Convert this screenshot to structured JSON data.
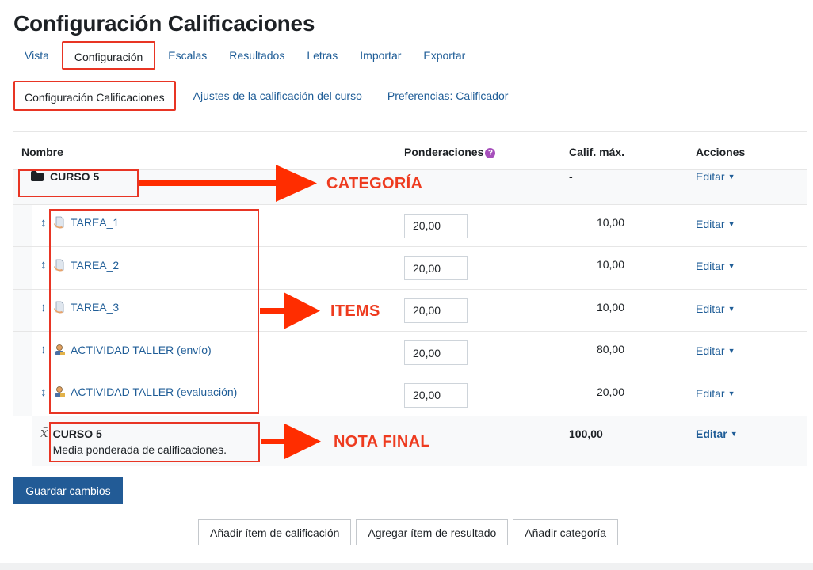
{
  "page": {
    "title": "Configuración Calificaciones"
  },
  "tabs_primary": [
    {
      "label": "Vista"
    },
    {
      "label": "Configuración"
    },
    {
      "label": "Escalas"
    },
    {
      "label": "Resultados"
    },
    {
      "label": "Letras"
    },
    {
      "label": "Importar"
    },
    {
      "label": "Exportar"
    }
  ],
  "tabs_secondary": [
    {
      "label": "Configuración Calificaciones"
    },
    {
      "label": "Ajustes de la calificación del curso"
    },
    {
      "label": "Preferencias: Calificador"
    }
  ],
  "table": {
    "headers": {
      "name": "Nombre",
      "weights": "Ponderaciones",
      "max": "Calif. máx.",
      "actions": "Acciones"
    },
    "category": {
      "name": "CURSO 5",
      "max": "-",
      "action": "Editar"
    },
    "items": [
      {
        "name": "TAREA_1",
        "weight": "20,00",
        "max": "10,00",
        "action": "Editar"
      },
      {
        "name": "TAREA_2",
        "weight": "20,00",
        "max": "10,00",
        "action": "Editar"
      },
      {
        "name": "TAREA_3",
        "weight": "20,00",
        "max": "10,00",
        "action": "Editar"
      },
      {
        "name": "ACTIVIDAD TALLER (envío)",
        "weight": "20,00",
        "max": "80,00",
        "action": "Editar"
      },
      {
        "name": "ACTIVIDAD TALLER (evaluación)",
        "weight": "20,00",
        "max": "20,00",
        "action": "Editar"
      }
    ],
    "total": {
      "name": "CURSO 5",
      "description": "Media ponderada de calificaciones.",
      "max": "100,00",
      "action": "Editar"
    }
  },
  "buttons": {
    "save": "Guardar cambios",
    "add_item": "Añadir ítem de calificación",
    "add_outcome": "Agregar ítem de resultado",
    "add_category": "Añadir categoría"
  },
  "annotations": {
    "category": "CATEGORÍA",
    "items": "ITEMS",
    "final": "NOTA FINAL",
    "color": "#e83524"
  },
  "colors": {
    "link": "#1f5d97",
    "primary_button": "#225b96",
    "help_icon": "#a64fbb"
  }
}
